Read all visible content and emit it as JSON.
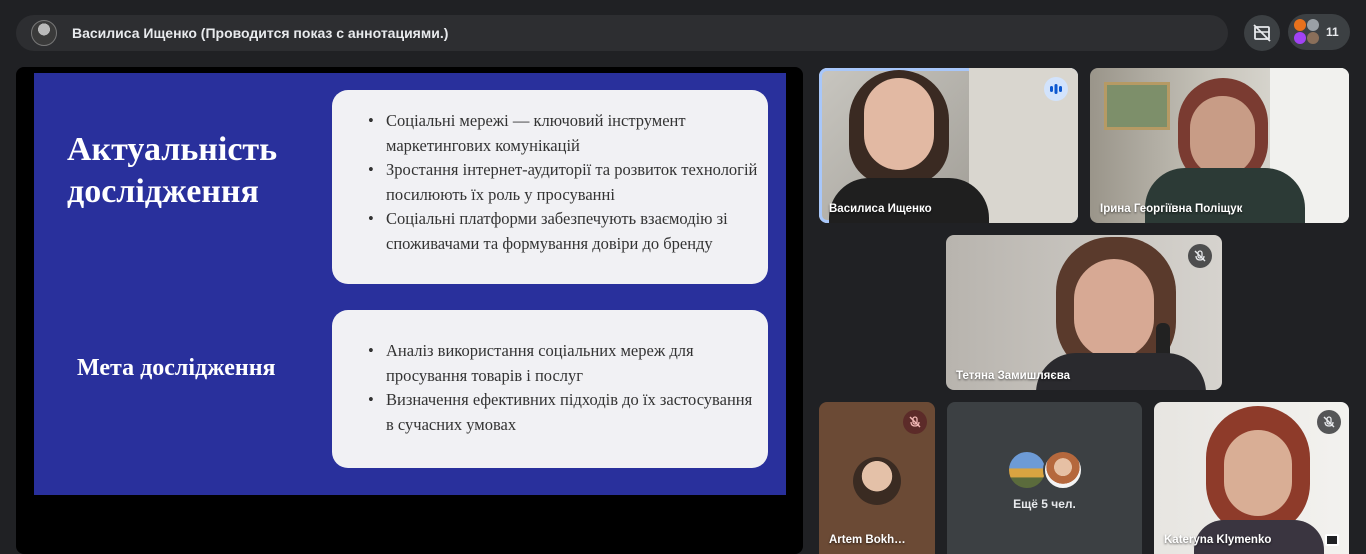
{
  "topbar": {
    "presenter_title": "Василиса Ищенко (Проводится показ с аннотациями.)",
    "people_count": "11"
  },
  "slide": {
    "heading1": "Актуальність дослідження",
    "heading2": "Мета дослідження",
    "bullets1": [
      "Соціальні мережі — ключовий інструмент маркетингових комунікацій",
      "Зростання інтернет-аудиторії та розвиток технологій посилюють їх роль у просуванні",
      "Соціальні платформи забезпечують взаємодію зі споживачами та формування довіри до бренду"
    ],
    "bullets2": [
      " Аналіз використання соціальних мереж для просування товарів і послуг",
      "Визначення ефективних підходів до їх застосування в сучасних умовах"
    ]
  },
  "tiles": {
    "vasylysa": "Василиса Ищенко",
    "iryna": "Ірина Георгіївна Поліщук",
    "tetiana": "Тетяна Замишляєва",
    "artem": "Artem Bokh…",
    "others": "Ещё 5 чел.",
    "kateryna": "Kateryna Klymenko"
  },
  "colors": {
    "slide_bg": "#29309c",
    "active_speaker_outline": "#a8c7fa",
    "muted_badge": "#5c2b29"
  }
}
